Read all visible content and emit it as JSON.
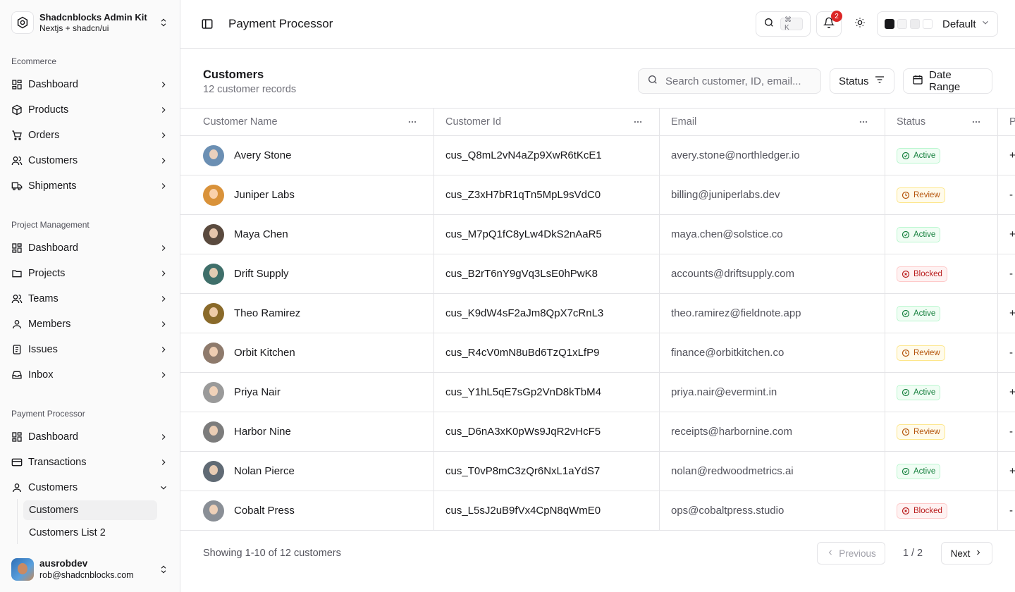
{
  "brand": {
    "title": "Shadcnblocks Admin Kit",
    "subtitle": "Nextjs + shadcn/ui"
  },
  "groups": [
    {
      "label": "Ecommerce",
      "items": [
        "Dashboard",
        "Products",
        "Orders",
        "Customers",
        "Shipments"
      ]
    },
    {
      "label": "Project Management",
      "items": [
        "Dashboard",
        "Projects",
        "Teams",
        "Members",
        "Issues",
        "Inbox"
      ]
    },
    {
      "label": "Payment Processor",
      "items": [
        "Dashboard",
        "Transactions",
        "Customers"
      ]
    }
  ],
  "subnav": [
    "Customers",
    "Customers List 2"
  ],
  "user": {
    "name": "ausrobdev",
    "email": "rob@shadcnblocks.com"
  },
  "header": {
    "title": "Payment Processor",
    "shortcut": "⌘ K",
    "notifications": "2",
    "theme": "Default"
  },
  "card": {
    "title": "Customers",
    "subtitle": "12 customer records",
    "search_placeholder": "Search customer, ID, email...",
    "status_label": "Status",
    "date_label": "Date Range"
  },
  "columns": [
    "Customer Name",
    "Customer Id",
    "Email",
    "Status",
    "P"
  ],
  "rows": [
    {
      "name": "Avery Stone",
      "id": "cus_Q8mL2vN4aZp9XwR6tKcE1",
      "email": "avery.stone@northledger.io",
      "status": "Active",
      "extra": "+"
    },
    {
      "name": "Juniper Labs",
      "id": "cus_Z3xH7bR1qTn5MpL9sVdC0",
      "email": "billing@juniperlabs.dev",
      "status": "Review",
      "extra": "-"
    },
    {
      "name": "Maya Chen",
      "id": "cus_M7pQ1fC8yLw4DkS2nAaR5",
      "email": "maya.chen@solstice.co",
      "status": "Active",
      "extra": "+"
    },
    {
      "name": "Drift Supply",
      "id": "cus_B2rT6nY9gVq3LsE0hPwK8",
      "email": "accounts@driftsupply.com",
      "status": "Blocked",
      "extra": "-"
    },
    {
      "name": "Theo Ramirez",
      "id": "cus_K9dW4sF2aJm8QpX7cRnL3",
      "email": "theo.ramirez@fieldnote.app",
      "status": "Active",
      "extra": "+"
    },
    {
      "name": "Orbit Kitchen",
      "id": "cus_R4cV0mN8uBd6TzQ1xLfP9",
      "email": "finance@orbitkitchen.co",
      "status": "Review",
      "extra": "-"
    },
    {
      "name": "Priya Nair",
      "id": "cus_Y1hL5qE7sGp2VnD8kTbM4",
      "email": "priya.nair@evermint.in",
      "status": "Active",
      "extra": "+"
    },
    {
      "name": "Harbor Nine",
      "id": "cus_D6nA3xK0pWs9JqR2vHcF5",
      "email": "receipts@harbornine.com",
      "status": "Review",
      "extra": "-"
    },
    {
      "name": "Nolan Pierce",
      "id": "cus_T0vP8mC3zQr6NxL1aYdS7",
      "email": "nolan@redwoodmetrics.ai",
      "status": "Active",
      "extra": "+"
    },
    {
      "name": "Cobalt Press",
      "id": "cus_L5sJ2uB9fVx4CpN8qWmE0",
      "email": "ops@cobaltpress.studio",
      "status": "Blocked",
      "extra": "-"
    }
  ],
  "avatar_colors": [
    "#6b8fb3",
    "#d9923a",
    "#5a4a3e",
    "#3f6f6a",
    "#8a6a2a",
    "#8e7a6c",
    "#9a9a9a",
    "#7c7c7c",
    "#606a74",
    "#8a8f96"
  ],
  "footer": {
    "showing": "Showing 1-10 of 12 customers",
    "previous": "Previous",
    "page": "1 / 2",
    "next": "Next"
  }
}
